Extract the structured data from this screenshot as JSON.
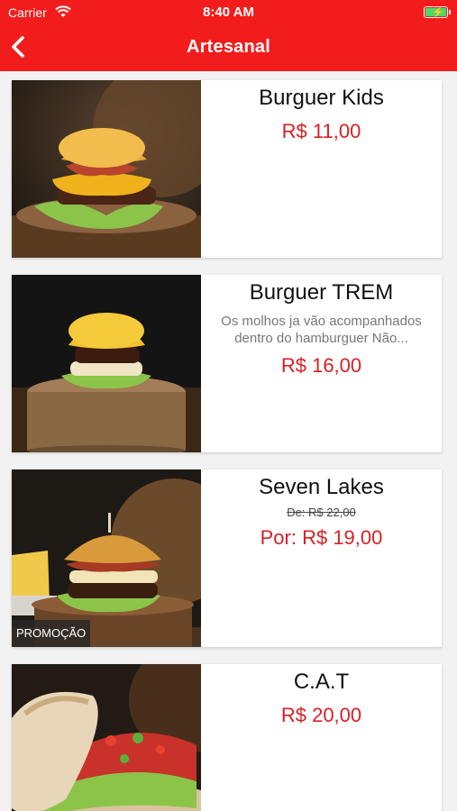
{
  "status_bar": {
    "carrier": "Carrier",
    "time": "8:40 AM"
  },
  "header": {
    "title": "Artesanal"
  },
  "colors": {
    "brand_red": "#f31c1c",
    "price_red": "#d81f26"
  },
  "products": [
    {
      "name": "Burguer Kids",
      "price": "R$ 11,00"
    },
    {
      "name": "Burguer TREM",
      "description": "Os molhos ja vão acompanhados dentro do hamburguer Não...",
      "price": "R$ 16,00"
    },
    {
      "name": "Seven Lakes",
      "old_price": "De: R$ 22,00",
      "price": "Por: R$ 19,00",
      "badge": "PROMOÇÃO"
    },
    {
      "name": "C.A.T",
      "price": "R$ 20,00"
    }
  ]
}
